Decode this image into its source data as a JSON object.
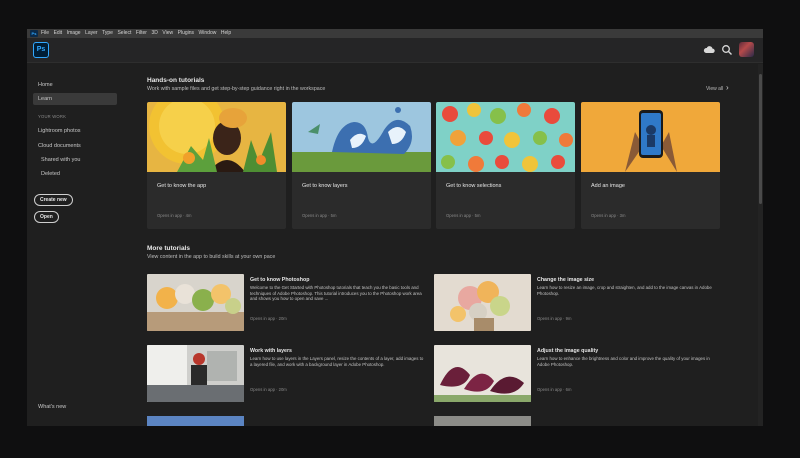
{
  "menubar": {
    "app_badge": "Ps",
    "items": [
      "File",
      "Edit",
      "Image",
      "Layer",
      "Type",
      "Select",
      "Filter",
      "3D",
      "View",
      "Plugins",
      "Window",
      "Help"
    ]
  },
  "header": {
    "logo": "Ps",
    "icons": [
      "cloud-icon",
      "search-icon",
      "avatar"
    ]
  },
  "sidebar": {
    "home": "Home",
    "learn": "Learn",
    "your_work_label": "YOUR WORK",
    "lightroom": "Lightroom photos",
    "cloud_documents": "Cloud documents",
    "shared_with_you": "Shared with you",
    "deleted": "Deleted",
    "create_new": "Create new",
    "open": "Open",
    "whats_new": "What's new"
  },
  "hands_on": {
    "title": "Hands-on tutorials",
    "subtitle": "Work with sample files and get step-by-step guidance right in the workspace",
    "view_all": "View all",
    "cards": [
      {
        "title": "Get to know the app",
        "meta": "Opens in app  ·  4m"
      },
      {
        "title": "Get to know layers",
        "meta": "Opens in app  ·  5m"
      },
      {
        "title": "Get to know selections",
        "meta": "Opens in app  ·  5m"
      },
      {
        "title": "Add an image",
        "meta": "Opens in app  ·  3m"
      }
    ]
  },
  "more": {
    "title": "More tutorials",
    "subtitle": "View content in the app to build skills at your own pace",
    "items": [
      {
        "title": "Get to know Photoshop",
        "desc": "Welcome to the Get Started with Photoshop tutorials that teach you the basic tools and techniques of Adobe Photoshop. This tutorial introduces you to the Photoshop work area and shows you how to open and save ...",
        "meta": "Opens in app  ·  20m"
      },
      {
        "title": "Change the image size",
        "desc": "Learn how to resize an image, crop and straighten, and add to the image canvas in Adobe Photoshop.",
        "meta": "Opens in app  ·  9m"
      },
      {
        "title": "Work with layers",
        "desc": "Learn how to use layers in the Layers panel, resize the contents of a layer, add images to a layered file, and work with a background layer in Adobe Photoshop.",
        "meta": "Opens in app  ·  20m"
      },
      {
        "title": "Adjust the image quality",
        "desc": "Learn how to enhance the brightness and color and improve the quality of your images in Adobe Photoshop.",
        "meta": "Opens in app  ·  6m"
      }
    ]
  },
  "colors": {
    "ps_blue": "#31a8ff",
    "background": "#1f1f1f",
    "card": "#2b2b2b"
  }
}
